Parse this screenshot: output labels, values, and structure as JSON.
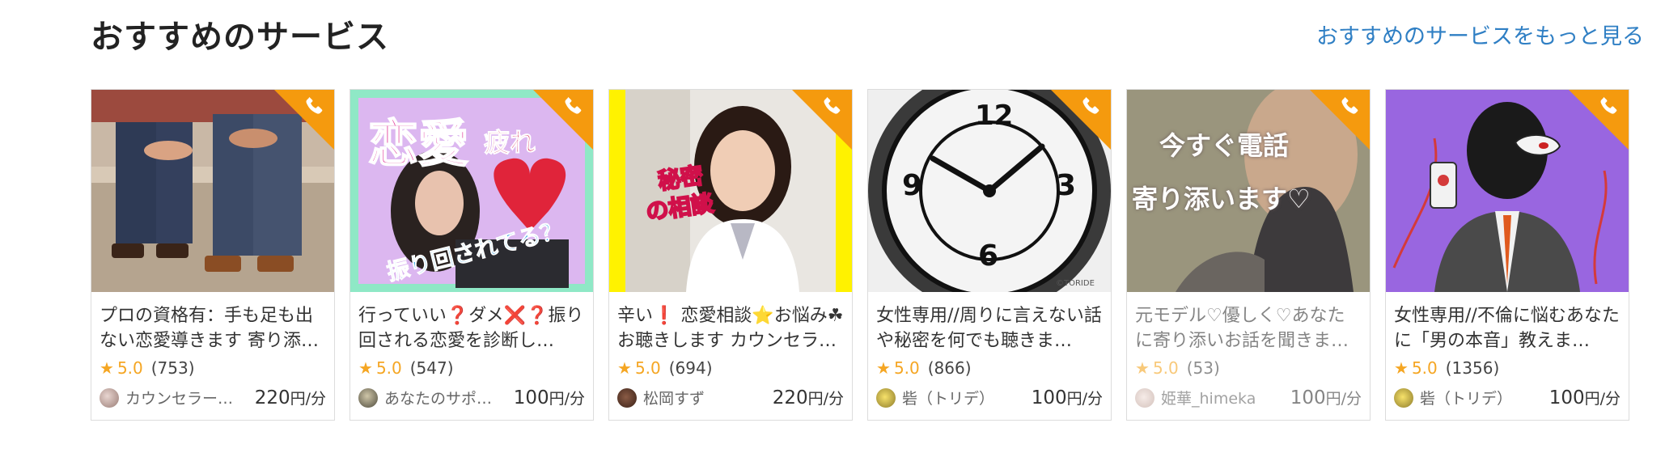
{
  "section": {
    "title": "おすすめのサービス",
    "more_link": "おすすめのサービスをもっと見る"
  },
  "colors": {
    "accent": "#f59a0e",
    "link": "#2f7fc4",
    "star": "#f5a623"
  },
  "cards": [
    {
      "title": "プロの資格有：手も足も出ない恋愛導きます 寄り添…",
      "rating": "5.0",
      "reviews": "(753)",
      "seller": "カウンセラー…",
      "price": "220",
      "price_unit": "円/分",
      "thumb_text": []
    },
    {
      "title": "行っていい❓ダメ❌❓振り回される恋愛を診断し…",
      "rating": "5.0",
      "reviews": "(547)",
      "seller": "あなたのサポ…",
      "price": "100",
      "price_unit": "円/分",
      "thumb_text": [
        "恋愛",
        "疲れ",
        "振り回されてる？"
      ]
    },
    {
      "title": "辛い❗ 恋愛相談⭐お悩み☘お聴きします カウンセラ…",
      "rating": "5.0",
      "reviews": "(694)",
      "seller": "松岡すず",
      "price": "220",
      "price_unit": "円/分",
      "thumb_text": [
        "秘密",
        "の相談"
      ]
    },
    {
      "title": "女性専用//周りに言えない話や秘密を何でも聴きま…",
      "rating": "5.0",
      "reviews": "(866)",
      "seller": "砦（トリデ）",
      "price": "100",
      "price_unit": "円/分",
      "thumb_text": [
        "12",
        "9",
        "3",
        "6",
        "©TORIDE"
      ]
    },
    {
      "title": "元モデル♡優しく♡あなたに寄り添いお話を聞きま…",
      "rating": "5.0",
      "reviews": "(53)",
      "seller": "姫華_himeka",
      "price": "100",
      "price_unit": "円/分",
      "thumb_text": [
        "今すぐ電話",
        "寄り添います♡"
      ]
    },
    {
      "title": "女性専用//不倫に悩むあなたに「男の本音」教えま…",
      "rating": "5.0",
      "reviews": "(1356)",
      "seller": "砦（トリデ）",
      "price": "100",
      "price_unit": "円/分",
      "thumb_text": []
    }
  ]
}
